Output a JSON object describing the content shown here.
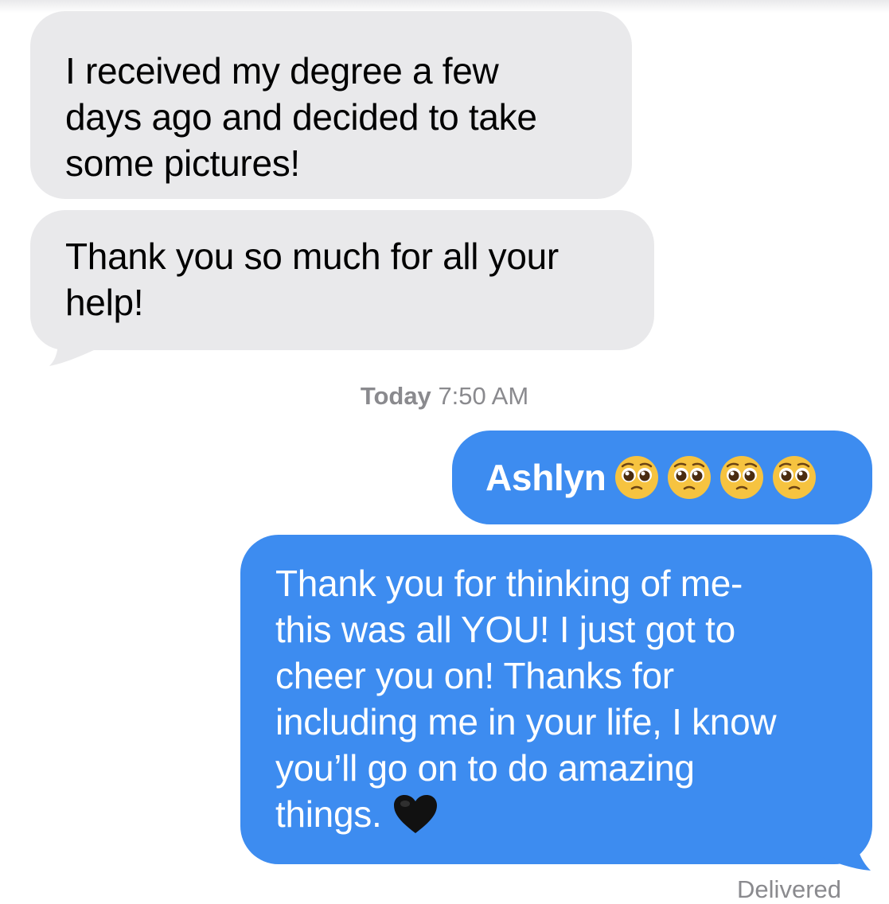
{
  "conversation": {
    "received": [
      {
        "lines": [
          "I received my degree a few",
          "days ago and decided to take",
          "some pictures!"
        ]
      },
      {
        "lines": [
          "Thank you so much for all your",
          "help!"
        ]
      }
    ],
    "timestamp": {
      "day": "Today",
      "time": "7:50 AM"
    },
    "sent": [
      {
        "name": "Ashlyn",
        "emoji": [
          "pleading-face",
          "pleading-face",
          "pleading-face",
          "pleading-face"
        ]
      },
      {
        "lines": [
          "Thank you for thinking of me-",
          "this was all YOU! I just got to",
          "cheer you on! Thanks for",
          "including me in your life, I know",
          "you’ll go on to do amazing",
          "things."
        ],
        "emoji": "black-heart"
      }
    ],
    "status": "Delivered"
  },
  "colors": {
    "received_bubble": "#e9e9eb",
    "sent_bubble": "#3d8cf0",
    "meta_text": "#8a8a8e"
  }
}
